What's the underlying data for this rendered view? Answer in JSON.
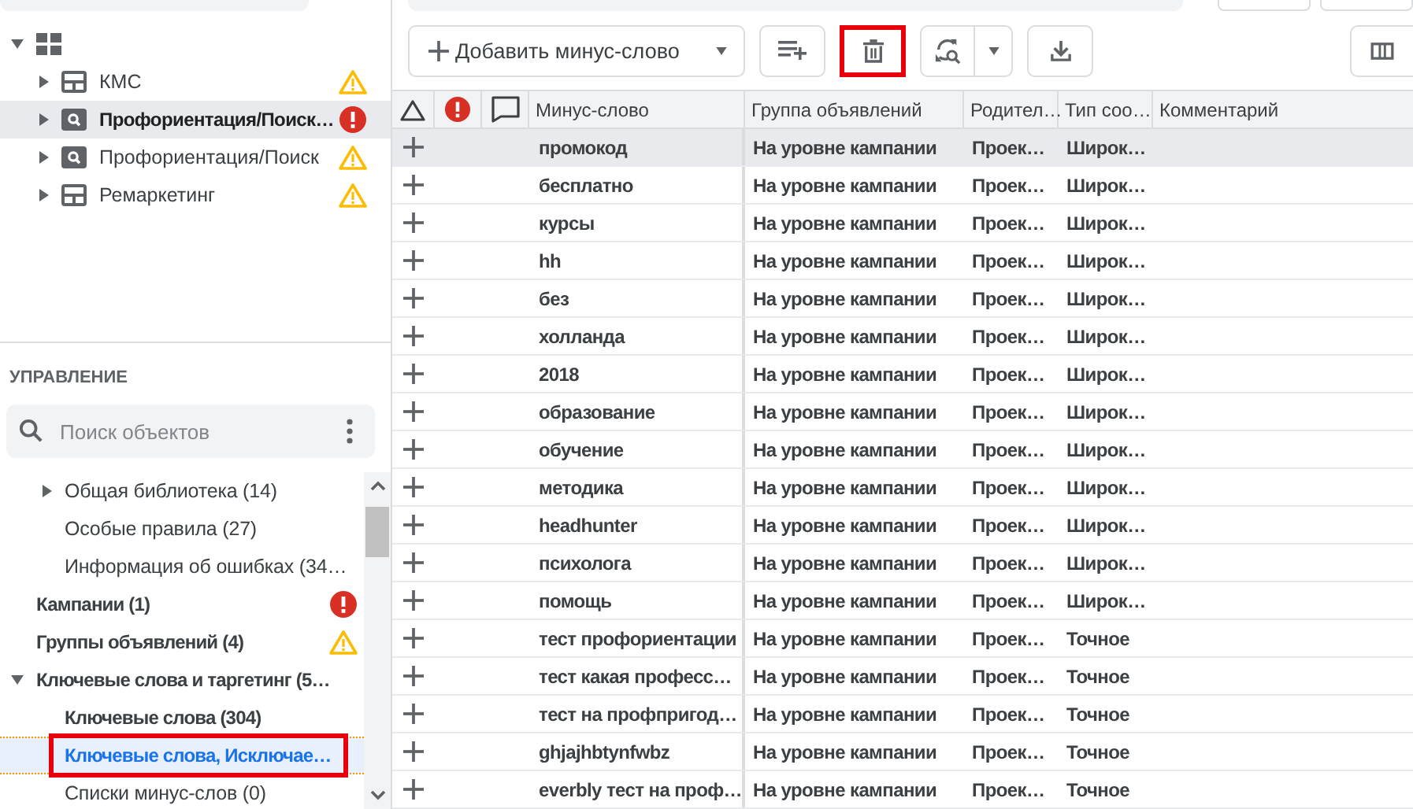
{
  "left_panel": {
    "tree": {
      "expanded": true,
      "children": [
        {
          "label": "КМС",
          "kind": "display",
          "warning": true,
          "error": false,
          "selected": false
        },
        {
          "label": "Профориентация/Поиск…",
          "kind": "search",
          "warning": false,
          "error": true,
          "selected": true
        },
        {
          "label": "Профориентация/Поиск",
          "kind": "search",
          "warning": true,
          "error": false,
          "selected": false
        },
        {
          "label": "Ремаркетинг",
          "kind": "display",
          "warning": true,
          "error": false,
          "selected": false
        }
      ]
    },
    "manage": {
      "title": "УПРАВЛЕНИЕ",
      "search": {
        "placeholder": "Поиск объектов"
      },
      "continued_items": [
        {
          "label": "Общая библиотека (14)",
          "bold": false,
          "expanded": false,
          "selected": false,
          "highlighted": false
        },
        {
          "label": "Особые правила (27)",
          "bold": false,
          "selected": false,
          "highlighted": false
        },
        {
          "label": "Информация об ошибках (34…",
          "bold": false,
          "selected": false,
          "highlighted": false
        }
      ],
      "items": [
        {
          "label": "Кампании (1)",
          "bold": true,
          "warning": false,
          "error": true,
          "selected": false,
          "highlighted": false
        },
        {
          "label": "Группы объявлений (4)",
          "bold": true,
          "warning": true,
          "error": false,
          "selected": false,
          "highlighted": false
        },
        {
          "label": "Ключевые слова и таргетинг (5…",
          "bold": true,
          "expanded": true,
          "selected": false,
          "highlighted": false,
          "children": [
            {
              "label": "Ключевые слова (304)",
              "bold": true,
              "selected": false,
              "highlighted": false
            },
            {
              "label": "Ключевые слова, Исключае…",
              "bold": true,
              "selected": true,
              "highlighted": true
            },
            {
              "label": "Списки минус-слов (0)",
              "bold": false,
              "selected": false,
              "highlighted": false
            }
          ]
        }
      ]
    }
  },
  "toolbar": {
    "buttons": [
      {
        "kind": "add",
        "label": "Добавить минус-слово",
        "highlighted": false
      },
      {
        "kind": "add-list",
        "highlighted": false
      },
      {
        "kind": "delete",
        "highlighted": true
      },
      {
        "kind": "refresh",
        "highlighted": false
      },
      {
        "kind": "download",
        "highlighted": false
      },
      {
        "kind": "columns",
        "highlighted": false
      }
    ]
  },
  "table": {
    "columns": [
      {
        "kind": "triangle"
      },
      {
        "kind": "error"
      },
      {
        "kind": "comment"
      },
      {
        "kind": "text",
        "label": "Минус-слово"
      },
      {
        "kind": "text",
        "label": "Группа объявлений"
      },
      {
        "kind": "text",
        "label": "Родител…"
      },
      {
        "kind": "text",
        "label": "Тип соо…"
      },
      {
        "kind": "text",
        "label": "Комментарий"
      }
    ],
    "rows": [
      {
        "keyword": "промокод",
        "ad_group": "На уровне кампании",
        "parent": "Проек…",
        "match_type": "Широк…",
        "selected": true
      },
      {
        "keyword": "бесплатно",
        "ad_group": "На уровне кампании",
        "parent": "Проек…",
        "match_type": "Широк…",
        "selected": false
      },
      {
        "keyword": "курсы",
        "ad_group": "На уровне кампании",
        "parent": "Проек…",
        "match_type": "Широк…",
        "selected": false
      },
      {
        "keyword": "hh",
        "ad_group": "На уровне кампании",
        "parent": "Проек…",
        "match_type": "Широк…",
        "selected": false
      },
      {
        "keyword": "без",
        "ad_group": "На уровне кампании",
        "parent": "Проек…",
        "match_type": "Широк…",
        "selected": false
      },
      {
        "keyword": "холланда",
        "ad_group": "На уровне кампании",
        "parent": "Проек…",
        "match_type": "Широк…",
        "selected": false
      },
      {
        "keyword": "2018",
        "ad_group": "На уровне кампании",
        "parent": "Проек…",
        "match_type": "Широк…",
        "selected": false
      },
      {
        "keyword": "образование",
        "ad_group": "На уровне кампании",
        "parent": "Проек…",
        "match_type": "Широк…",
        "selected": false
      },
      {
        "keyword": "обучение",
        "ad_group": "На уровне кампании",
        "parent": "Проек…",
        "match_type": "Широк…",
        "selected": false
      },
      {
        "keyword": "методика",
        "ad_group": "На уровне кампании",
        "parent": "Проек…",
        "match_type": "Широк…",
        "selected": false
      },
      {
        "keyword": "headhunter",
        "ad_group": "На уровне кампании",
        "parent": "Проек…",
        "match_type": "Широк…",
        "selected": false
      },
      {
        "keyword": "психолога",
        "ad_group": "На уровне кампании",
        "parent": "Проек…",
        "match_type": "Широк…",
        "selected": false
      },
      {
        "keyword": "помощь",
        "ad_group": "На уровне кампании",
        "parent": "Проек…",
        "match_type": "Широк…",
        "selected": false
      },
      {
        "keyword": "тест профориентации",
        "ad_group": "На уровне кампании",
        "parent": "Проек…",
        "match_type": "Точное",
        "selected": false
      },
      {
        "keyword": "тест какая професс…",
        "ad_group": "На уровне кампании",
        "parent": "Проек…",
        "match_type": "Точное",
        "selected": false
      },
      {
        "keyword": "тест на профпригод…",
        "ad_group": "На уровне кампании",
        "parent": "Проек…",
        "match_type": "Точное",
        "selected": false
      },
      {
        "keyword": "ghjajhbtynfwbz",
        "ad_group": "На уровне кампании",
        "parent": "Проек…",
        "match_type": "Точное",
        "selected": false
      },
      {
        "keyword": "everbly тест на проф…",
        "ad_group": "На уровне кампании",
        "parent": "Проек…",
        "match_type": "Точное",
        "selected": false
      }
    ]
  }
}
